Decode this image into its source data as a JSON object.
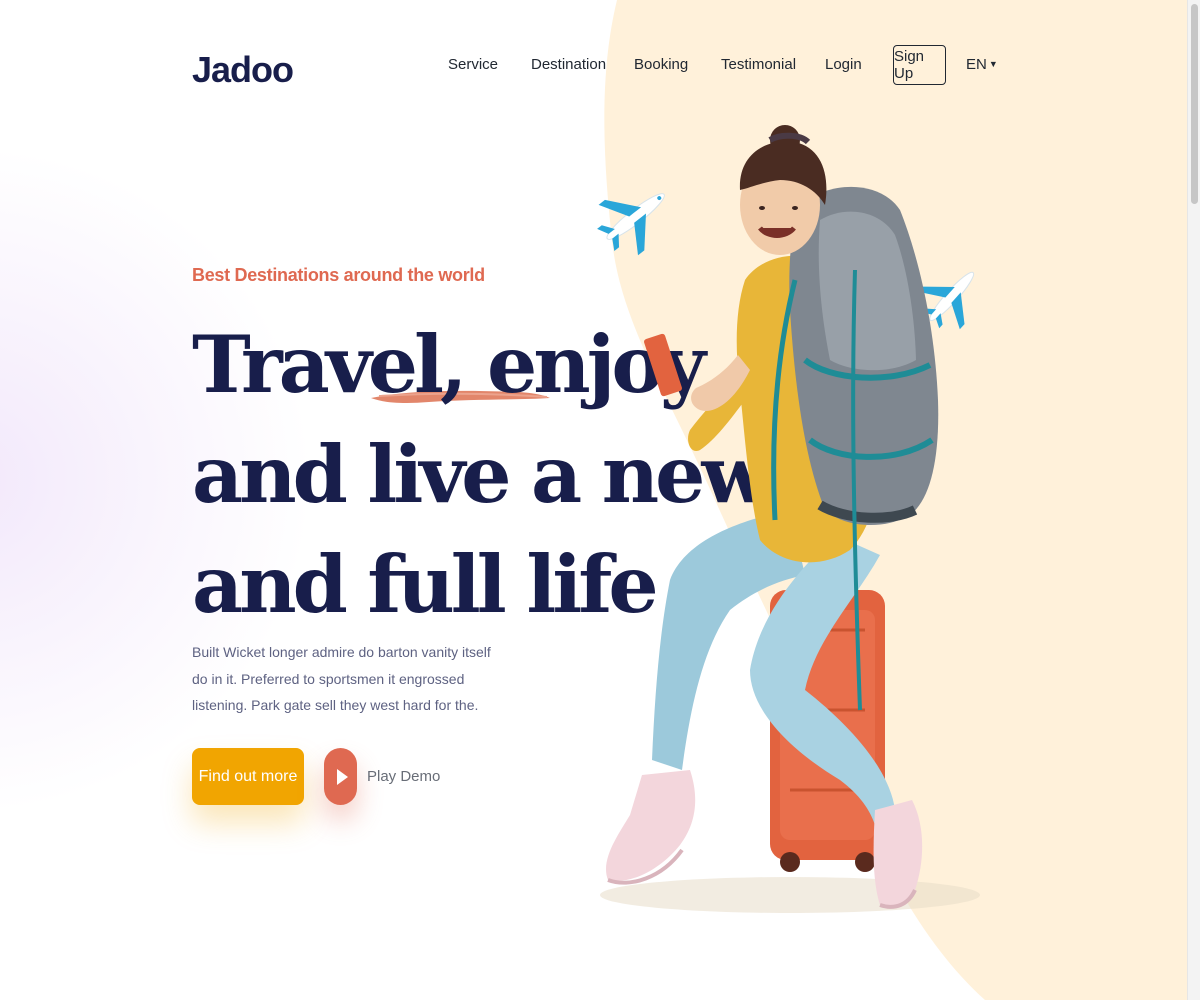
{
  "brand": {
    "logo_text": "Jadoo",
    "accent_color": "#df6951",
    "primary_color": "#181e4b",
    "cta_color": "#f1a501",
    "hero_bg_color": "#fff1da"
  },
  "nav": {
    "items": [
      "Service",
      "Destination",
      "Booking",
      "Testimonial",
      "Login"
    ],
    "signup_label": "Sign Up",
    "language": "EN"
  },
  "hero": {
    "tagline": "Best Destinations around the world",
    "headline_lines": [
      "Travel, enjoy",
      "and live a new",
      "and full life"
    ],
    "description": "Built Wicket longer admire do barton vanity itself do in it. Preferred to sportsmen it engrossed listening. Park gate sell they west hard for the.",
    "cta_label": "Find out more",
    "play_label": "Play Demo"
  },
  "icons": {
    "logo": "jadoo-logo",
    "language_caret": "caret-down-icon",
    "play": "play-icon",
    "plane": "airplane-icon",
    "traveler": "traveler-illustration"
  }
}
